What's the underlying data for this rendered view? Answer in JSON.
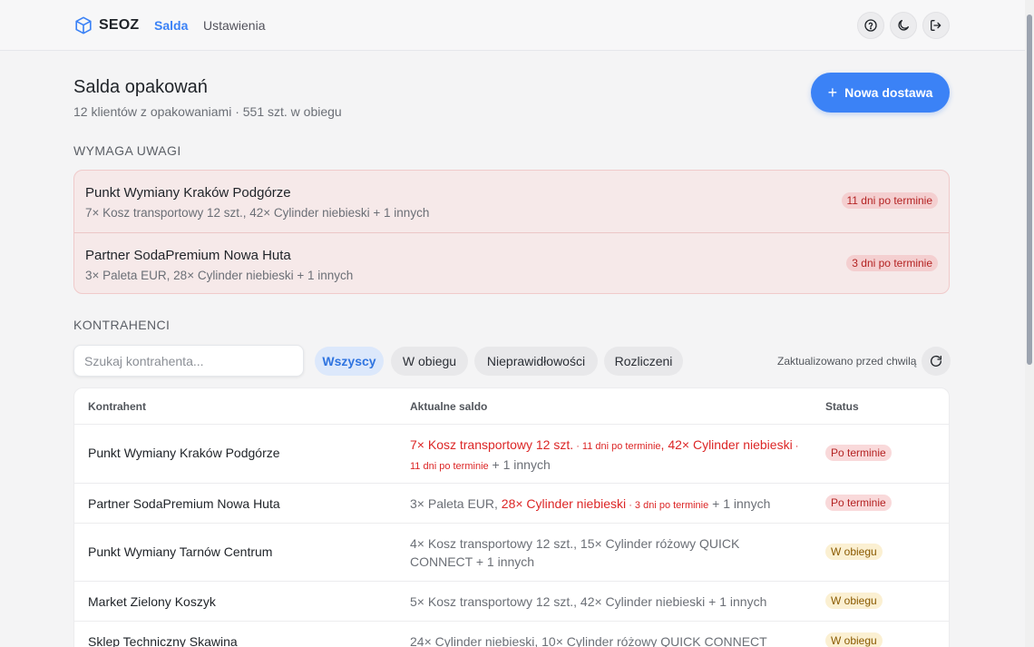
{
  "header": {
    "brand": "SEOZ",
    "nav": {
      "active": "Salda",
      "other": "Ustawienia"
    },
    "icons": [
      "help-icon",
      "moon-icon",
      "logout-icon"
    ]
  },
  "page": {
    "title": "Salda opakowań",
    "subtitle": "12 klientów z opakowaniami · 551 szt. w obiegu",
    "new_button": "Nowa dostawa"
  },
  "attention": {
    "label": "WYMAGA UWAGI",
    "items": [
      {
        "name": "Punkt Wymiany Kraków Podgórze",
        "desc": "7× Kosz transportowy 12 szt., 42× Cylinder niebieski + 1 innych",
        "badge": "11 dni po terminie"
      },
      {
        "name": "Partner SodaPremium Nowa Huta",
        "desc": "3× Paleta EUR, 28× Cylinder niebieski + 1 innych",
        "badge": "3 dni po terminie"
      }
    ]
  },
  "contractors": {
    "label": "KONTRAHENCI",
    "search_placeholder": "Szukaj kontrahenta...",
    "filters": [
      "Wszyscy",
      "W obiegu",
      "Nieprawidłowości",
      "Rozliczeni"
    ],
    "active_filter": "Wszyscy",
    "updated": "Zaktualizowano przed chwilą"
  },
  "table": {
    "columns": [
      "Kontrahent",
      "Aktualne saldo",
      "Status"
    ],
    "rows": [
      {
        "name": "Punkt Wymiany Kraków Podgórze",
        "saldo": {
          "r1": "7× Kosz transportowy 12 szt.",
          "n1": " · 11 dni po terminie",
          "sep": ", ",
          "r2": "42× Cylinder niebieski",
          "n2": " · 11 dni po terminie",
          "tail": " + 1 innych"
        },
        "status": "Po terminie"
      },
      {
        "name": "Partner SodaPremium Nowa Huta",
        "saldo": {
          "head": "3× Paleta EUR, ",
          "r1": "28× Cylinder niebieski",
          "n1": " · 3 dni po terminie",
          "tail": " + 1 innych"
        },
        "status": "Po terminie"
      },
      {
        "name": "Punkt Wymiany Tarnów Centrum",
        "saldo": "4× Kosz transportowy 12 szt., 15× Cylinder różowy QUICK CONNECT + 1 innych",
        "status": "W obiegu"
      },
      {
        "name": "Market Zielony Koszyk",
        "saldo": "5× Kosz transportowy 12 szt., 42× Cylinder niebieski + 1 innych",
        "status": "W obiegu"
      },
      {
        "name": "Sklep Techniczny Skawina",
        "saldo": "24× Cylinder niebieski, 10× Cylinder różowy QUICK CONNECT",
        "status": "W obiegu"
      }
    ]
  },
  "colors": {
    "accent": "#3b82f6",
    "danger": "#dc2626",
    "warning_bg": "#fbf0d2"
  }
}
